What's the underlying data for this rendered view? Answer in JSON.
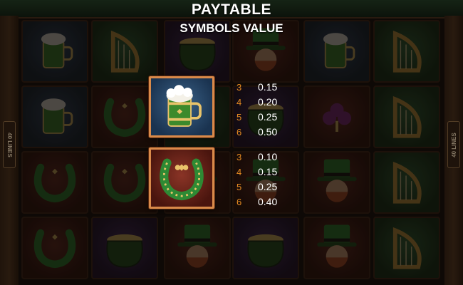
{
  "header": {
    "title": "PAYTABLE",
    "subtitle": "SYMBOLS VALUE"
  },
  "frame": {
    "lines_label_left": "40 LINES",
    "lines_label_right": "40 LINES"
  },
  "reels": [
    [
      "mug-icon",
      "mug-icon",
      "horseshoe-icon",
      "horseshoe-icon"
    ],
    [
      "harp-icon",
      "horseshoe-icon",
      "horseshoe-icon",
      "pot-of-gold-icon"
    ],
    [
      "pot-of-gold-icon",
      "harp-icon",
      "leprechaun-icon",
      "leprechaun-icon"
    ],
    [
      "leprechaun-icon",
      "pot-of-gold-icon",
      "leprechaun-icon",
      "pot-of-gold-icon"
    ],
    [
      "mug-icon",
      "clover-icon",
      "leprechaun-icon",
      "leprechaun-icon"
    ],
    [
      "harp-icon",
      "harp-icon",
      "harp-icon",
      "harp-icon"
    ]
  ],
  "paytable": [
    {
      "symbol": "mug-icon",
      "rows": [
        {
          "count": "3",
          "value": "0.15"
        },
        {
          "count": "4",
          "value": "0.20"
        },
        {
          "count": "5",
          "value": "0.25"
        },
        {
          "count": "6",
          "value": "0.50"
        }
      ]
    },
    {
      "symbol": "horseshoe-icon",
      "rows": [
        {
          "count": "3",
          "value": "0.10"
        },
        {
          "count": "4",
          "value": "0.15"
        },
        {
          "count": "5",
          "value": "0.25"
        },
        {
          "count": "6",
          "value": "0.40"
        }
      ]
    }
  ],
  "colors": {
    "count_text": "#e58a22",
    "value_text": "#ffffff",
    "highlight_border": "#d98a4a"
  }
}
